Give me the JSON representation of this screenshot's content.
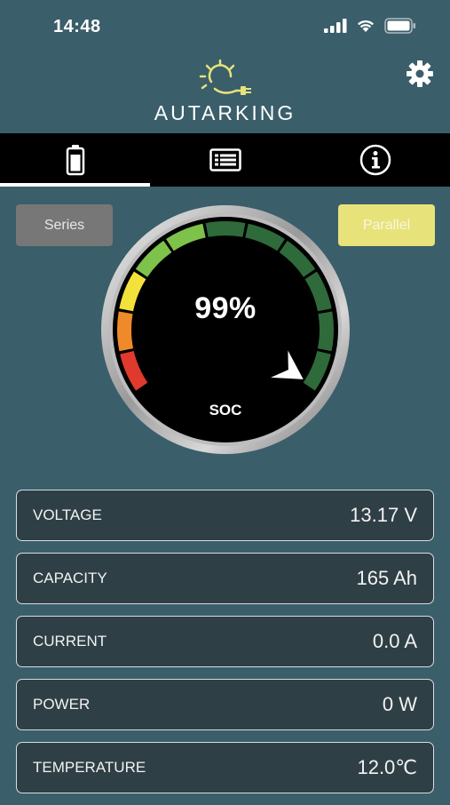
{
  "status": {
    "time": "14:48"
  },
  "header": {
    "brand": "AUTARKING"
  },
  "tabs": [
    {
      "name": "battery",
      "icon": "battery-icon",
      "active": true
    },
    {
      "name": "list",
      "icon": "list-icon",
      "active": false
    },
    {
      "name": "info",
      "icon": "info-icon",
      "active": false
    }
  ],
  "mode": {
    "series_label": "Series",
    "parallel_label": "Parallel",
    "selected": "Parallel"
  },
  "gauge": {
    "value_text": "99%",
    "label": "SOC",
    "soc_fraction": 0.99
  },
  "metrics": [
    {
      "label": "VOLTAGE",
      "value": "13.17 V"
    },
    {
      "label": "CAPACITY",
      "value": "165 Ah"
    },
    {
      "label": "CURRENT",
      "value": "0.0 A"
    },
    {
      "label": "POWER",
      "value": "0 W"
    },
    {
      "label": "TEMPERATURE",
      "value": "12.0℃"
    }
  ],
  "colors": {
    "background": "#3a5e6a",
    "accent": "#e8e27a",
    "gauge_red": "#e03a2e",
    "gauge_orange": "#ee8a2a",
    "gauge_yellow": "#f3e23a",
    "gauge_light_green": "#7dc24a",
    "gauge_dark_green": "#2f6a3a"
  }
}
